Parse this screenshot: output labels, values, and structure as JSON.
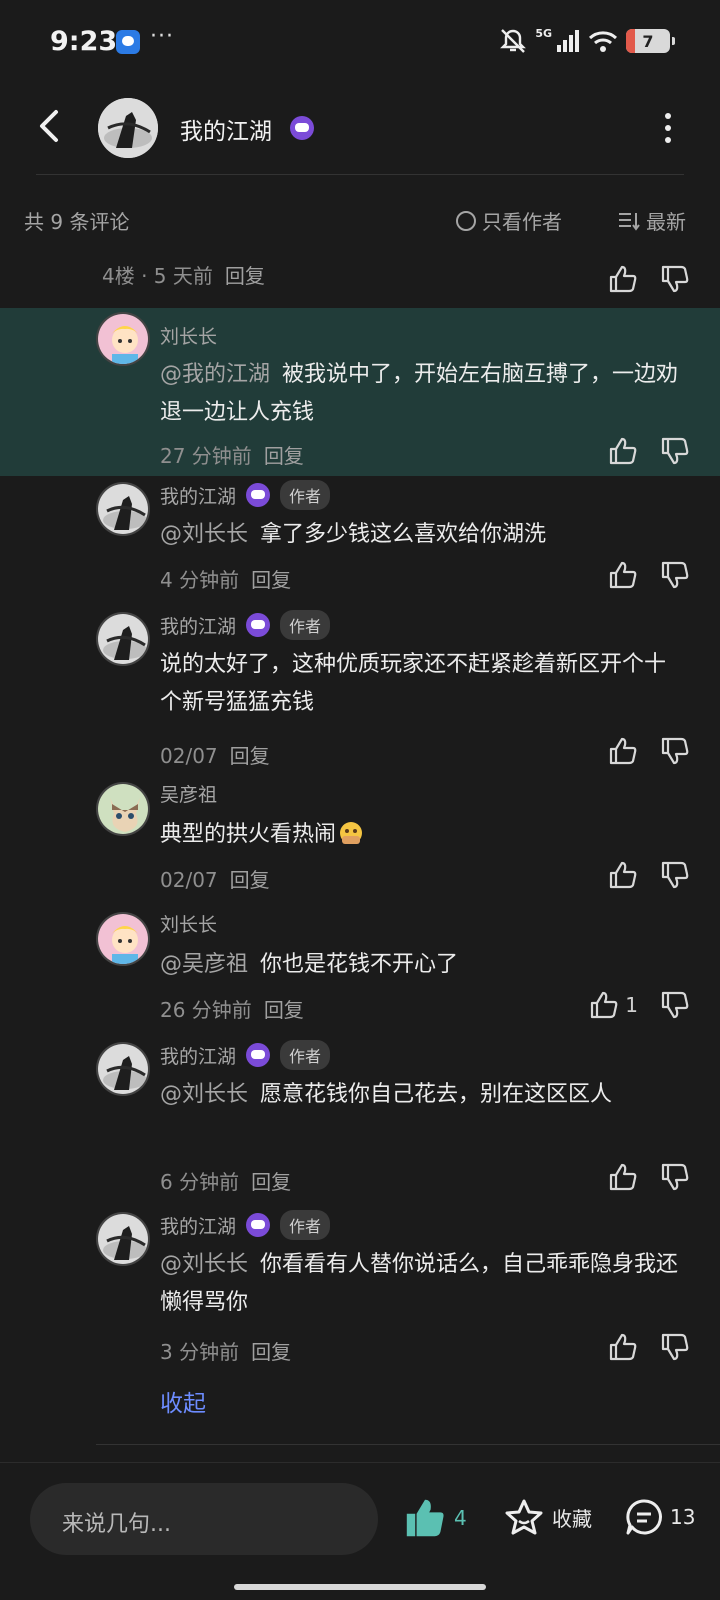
{
  "status_bar": {
    "time": "9:23",
    "dots": "···",
    "network": "5G",
    "battery": "7"
  },
  "header": {
    "title": "我的江湖"
  },
  "filter": {
    "count": "共 9 条评论",
    "author_only": "只看作者",
    "sort": "最新"
  },
  "floor": {
    "label": "4楼 · 5 天前",
    "reply": "回复"
  },
  "comments": [
    {
      "name": "刘长长",
      "mention": "@我的江湖",
      "text": "被我说中了，开始左右脑互搏了，一边劝退一边让人充钱",
      "time": "27 分钟前",
      "reply": "回复"
    },
    {
      "name": "我的江湖",
      "tag": "作者",
      "mention": "@刘长长",
      "text": "拿了多少钱这么喜欢给你湖洗",
      "time": "4 分钟前",
      "reply": "回复"
    },
    {
      "name": "我的江湖",
      "tag": "作者",
      "text": "说的太好了，这种优质玩家还不赶紧趁着新区开个十个新号猛猛充钱",
      "time": "02/07",
      "reply": "回复"
    },
    {
      "name": "吴彦祖",
      "text": "典型的拱火看热闹",
      "time": "02/07",
      "reply": "回复"
    },
    {
      "name": "刘长长",
      "mention": "@吴彦祖",
      "text": "你也是花钱不开心了",
      "time": "26 分钟前",
      "reply": "回复",
      "likes": "1"
    },
    {
      "name": "我的江湖",
      "tag": "作者",
      "mention": "@刘长长",
      "text": "愿意花钱你自己花去，别在这区区人",
      "time": "6 分钟前",
      "reply": "回复"
    },
    {
      "name": "我的江湖",
      "tag": "作者",
      "mention": "@刘长长",
      "text": "你看看有人替你说话么，自己乖乖隐身我还懒得骂你",
      "time": "3 分钟前",
      "reply": "回复"
    }
  ],
  "collapse": "收起",
  "bottom": {
    "placeholder": "来说几句...",
    "likes": "4",
    "favorite": "收藏",
    "comments": "13"
  }
}
